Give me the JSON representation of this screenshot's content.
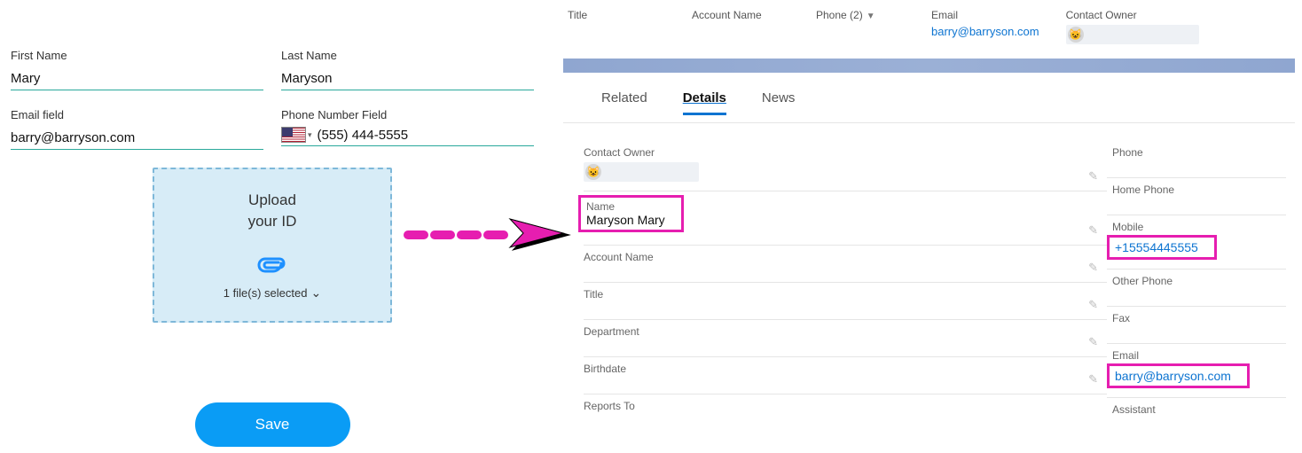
{
  "form": {
    "first_name_label": "First Name",
    "first_name_value": "Mary",
    "last_name_label": "Last Name",
    "last_name_value": "Maryson",
    "email_label": "Email field",
    "email_value": "barry@barryson.com",
    "phone_label": "Phone Number Field",
    "phone_value": "(555) 444-5555",
    "upload_line1": "Upload",
    "upload_line2": "your ID",
    "files_selected": "1 file(s) selected",
    "save_label": "Save"
  },
  "header": {
    "title_label": "Title",
    "account_label": "Account Name",
    "phone_label": "Phone (2)",
    "email_label": "Email",
    "email_value": "barry@barryson.com",
    "owner_label": "Contact Owner"
  },
  "tabs": {
    "related": "Related",
    "details": "Details",
    "news": "News"
  },
  "details_left": {
    "contact_owner": "Contact Owner",
    "name_label": "Name",
    "name_value": "Maryson Mary",
    "account_name": "Account Name",
    "title": "Title",
    "department": "Department",
    "birthdate": "Birthdate",
    "reports_to": "Reports To"
  },
  "details_right": {
    "phone": "Phone",
    "home_phone": "Home Phone",
    "mobile": "Mobile",
    "mobile_value": "+15554445555",
    "other_phone": "Other Phone",
    "fax": "Fax",
    "email": "Email",
    "email_value": "barry@barryson.com",
    "assistant": "Assistant"
  }
}
